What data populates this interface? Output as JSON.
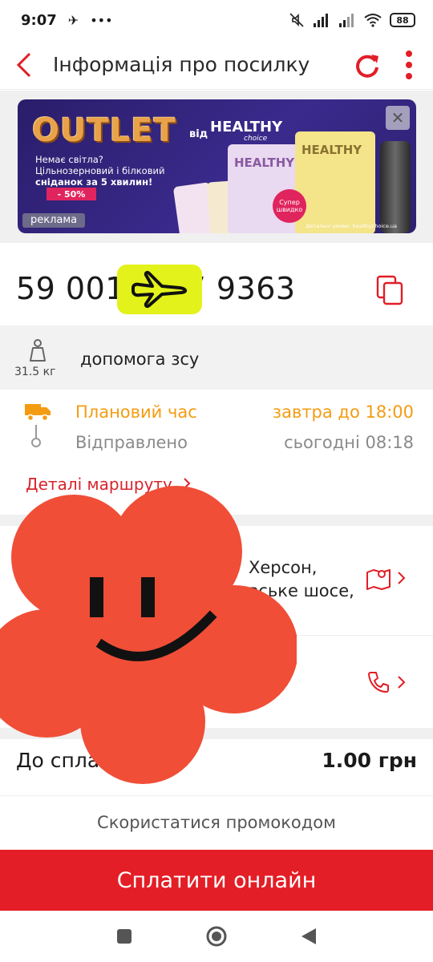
{
  "status_bar": {
    "time": "9:07",
    "battery": "88"
  },
  "app_bar": {
    "title": "Інформація про посилку"
  },
  "ad": {
    "outlet": "OUTLET",
    "vid": "від",
    "brand": "HEALTHY",
    "brand_sub": "choice",
    "line1": "Немає світла?",
    "line2": "Цільнозерновий і білковий",
    "line3": "сніданок за 5 хвилин!",
    "discount": "- 50%",
    "badge": "Супер швидко",
    "fine_print": "Детальні умови: healthychoice.ua",
    "label": "реклама",
    "close_symbol": "✕",
    "colors": {
      "background": "#2f2278",
      "outlet": "#e8a24a",
      "discount": "#e0245e"
    }
  },
  "tracking": {
    "number": "59 0015",
    "number_end": "7 9363"
  },
  "parcel": {
    "weight": "31.5 кг",
    "description": "допомога зсу"
  },
  "schedule": {
    "plan_label": "Плановий час",
    "plan_time": "завтра до 18:00",
    "sent_label": "Відправлено",
    "sent_time": "сьогодні 08:18",
    "route_link": "Деталі маршруту",
    "colors": {
      "plan": "#f39c12",
      "link": "#d9232d"
    }
  },
  "address": {
    "line1": "Херсон,",
    "line2": "вське шосе,"
  },
  "payment": {
    "label": "До спла",
    "amount": "1.00 грн"
  },
  "promo": {
    "label": "Скористатися промокодом"
  },
  "pay_button": {
    "label": "Сплатити онлайн",
    "color": "#e31e26"
  }
}
